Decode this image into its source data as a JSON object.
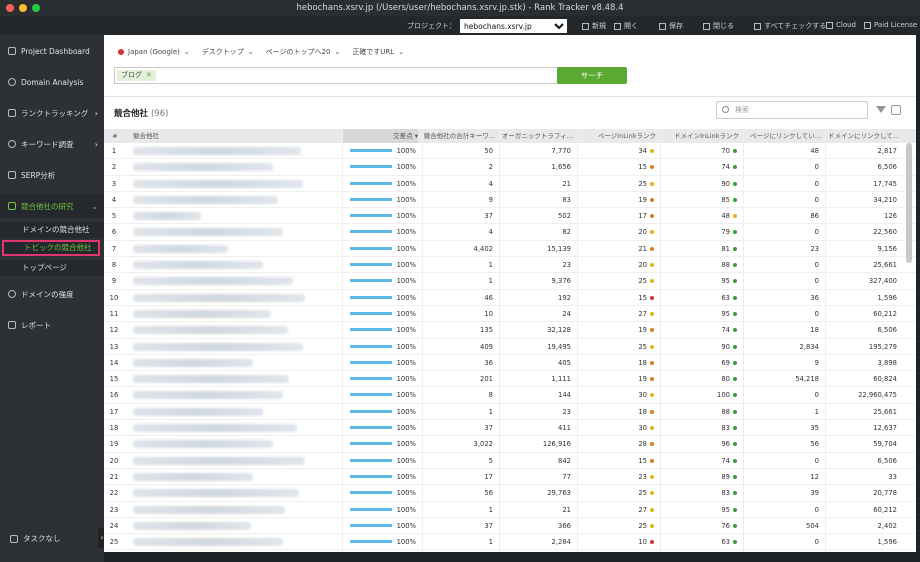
{
  "window": {
    "title": "hebochans.xsrv.jp (/Users/user/hebochans.xsrv.jp.stk) - Rank Tracker v8.48.4"
  },
  "toolbar": {
    "project_label": "プロジェクト：",
    "project_value": "hebochans.xsrv.jp",
    "new": "新規",
    "open": "開く",
    "save": "保存",
    "close": "閉じる",
    "check_all": "すべてチェックする",
    "cloud": "Cloud",
    "license": "Paid License"
  },
  "sidebar": {
    "items": [
      {
        "label": "Project Dashboard"
      },
      {
        "label": "Domain Analysis"
      },
      {
        "label": "ランクトラッキング"
      },
      {
        "label": "キーワード調査"
      },
      {
        "label": "SERP分析"
      },
      {
        "label": "競合他社の研究"
      },
      {
        "label": "ドメインの強度"
      },
      {
        "label": "レポート"
      }
    ],
    "subitems": [
      {
        "label": "ドメインの競合他社"
      },
      {
        "label": "トピックの競合他社"
      },
      {
        "label": "トップページ"
      }
    ],
    "bottom": "タスクなし"
  },
  "filters": {
    "country": "Japan (Google)",
    "device": "デスクトップ",
    "depth": "ページのトップへ20",
    "match": "正確ですURL"
  },
  "search": {
    "tag": "ブログ",
    "button": "サーチ"
  },
  "section": {
    "title": "競合他社",
    "count": "(96)",
    "search_placeholder": "検索"
  },
  "colors": {
    "accent": "#5aa932",
    "sidebar_active": "#6fc43a",
    "highlight": "#e0356f",
    "bar": "#5bb9e3"
  },
  "table": {
    "headers": [
      "#",
      "競合他社",
      "交差点",
      "競合他社の合計キーワ...",
      "オーガニックトラフィ...",
      "ページInLinkランク",
      "ドメインInLinkランク",
      "ページにリンクしてい...",
      "ドメインにリンクして..."
    ],
    "rows": [
      [
        "1",
        "100%",
        "50",
        "7,770",
        "34",
        "y",
        "70",
        "g",
        "48",
        "2,817"
      ],
      [
        "2",
        "100%",
        "2",
        "1,656",
        "15",
        "o",
        "74",
        "g",
        "0",
        "6,506"
      ],
      [
        "3",
        "100%",
        "4",
        "21",
        "25",
        "y",
        "90",
        "g",
        "0",
        "17,745"
      ],
      [
        "4",
        "100%",
        "9",
        "83",
        "19",
        "o",
        "85",
        "g",
        "0",
        "34,210"
      ],
      [
        "5",
        "100%",
        "37",
        "502",
        "17",
        "o",
        "48",
        "y",
        "86",
        "126"
      ],
      [
        "6",
        "100%",
        "4",
        "82",
        "20",
        "y",
        "79",
        "g",
        "0",
        "22,560"
      ],
      [
        "7",
        "100%",
        "4,402",
        "15,139",
        "21",
        "o",
        "81",
        "g",
        "23",
        "9,156"
      ],
      [
        "8",
        "100%",
        "1",
        "23",
        "20",
        "y",
        "88",
        "g",
        "0",
        "25,661"
      ],
      [
        "9",
        "100%",
        "1",
        "9,376",
        "25",
        "y",
        "95",
        "g",
        "0",
        "327,400"
      ],
      [
        "10",
        "100%",
        "46",
        "192",
        "15",
        "r",
        "63",
        "g",
        "36",
        "1,596"
      ],
      [
        "11",
        "100%",
        "10",
        "24",
        "27",
        "y",
        "95",
        "g",
        "0",
        "60,212"
      ],
      [
        "12",
        "100%",
        "135",
        "32,128",
        "19",
        "o",
        "74",
        "g",
        "18",
        "6,506"
      ],
      [
        "13",
        "100%",
        "409",
        "19,495",
        "25",
        "y",
        "90",
        "g",
        "2,834",
        "195,279"
      ],
      [
        "14",
        "100%",
        "36",
        "405",
        "18",
        "o",
        "69",
        "g",
        "9",
        "3,898"
      ],
      [
        "15",
        "100%",
        "201",
        "1,111",
        "19",
        "o",
        "80",
        "g",
        "54,218",
        "60,824"
      ],
      [
        "16",
        "100%",
        "8",
        "144",
        "30",
        "y",
        "100",
        "g",
        "0",
        "22,960,475"
      ],
      [
        "17",
        "100%",
        "1",
        "23",
        "18",
        "o",
        "88",
        "g",
        "1",
        "25,661"
      ],
      [
        "18",
        "100%",
        "37",
        "411",
        "30",
        "y",
        "83",
        "g",
        "35",
        "12,637"
      ],
      [
        "19",
        "100%",
        "3,022",
        "126,916",
        "28",
        "o",
        "96",
        "g",
        "56",
        "59,704"
      ],
      [
        "20",
        "100%",
        "5",
        "842",
        "15",
        "o",
        "74",
        "g",
        "0",
        "6,506"
      ],
      [
        "21",
        "100%",
        "17",
        "77",
        "23",
        "y",
        "89",
        "g",
        "12",
        "33"
      ],
      [
        "22",
        "100%",
        "56",
        "29,763",
        "25",
        "y",
        "83",
        "g",
        "39",
        "20,778"
      ],
      [
        "23",
        "100%",
        "1",
        "21",
        "27",
        "y",
        "95",
        "g",
        "0",
        "60,212"
      ],
      [
        "24",
        "100%",
        "37",
        "366",
        "25",
        "y",
        "76",
        "g",
        "504",
        "2,402"
      ],
      [
        "25",
        "100%",
        "1",
        "2,284",
        "10",
        "r",
        "63",
        "g",
        "0",
        "1,596"
      ]
    ]
  }
}
